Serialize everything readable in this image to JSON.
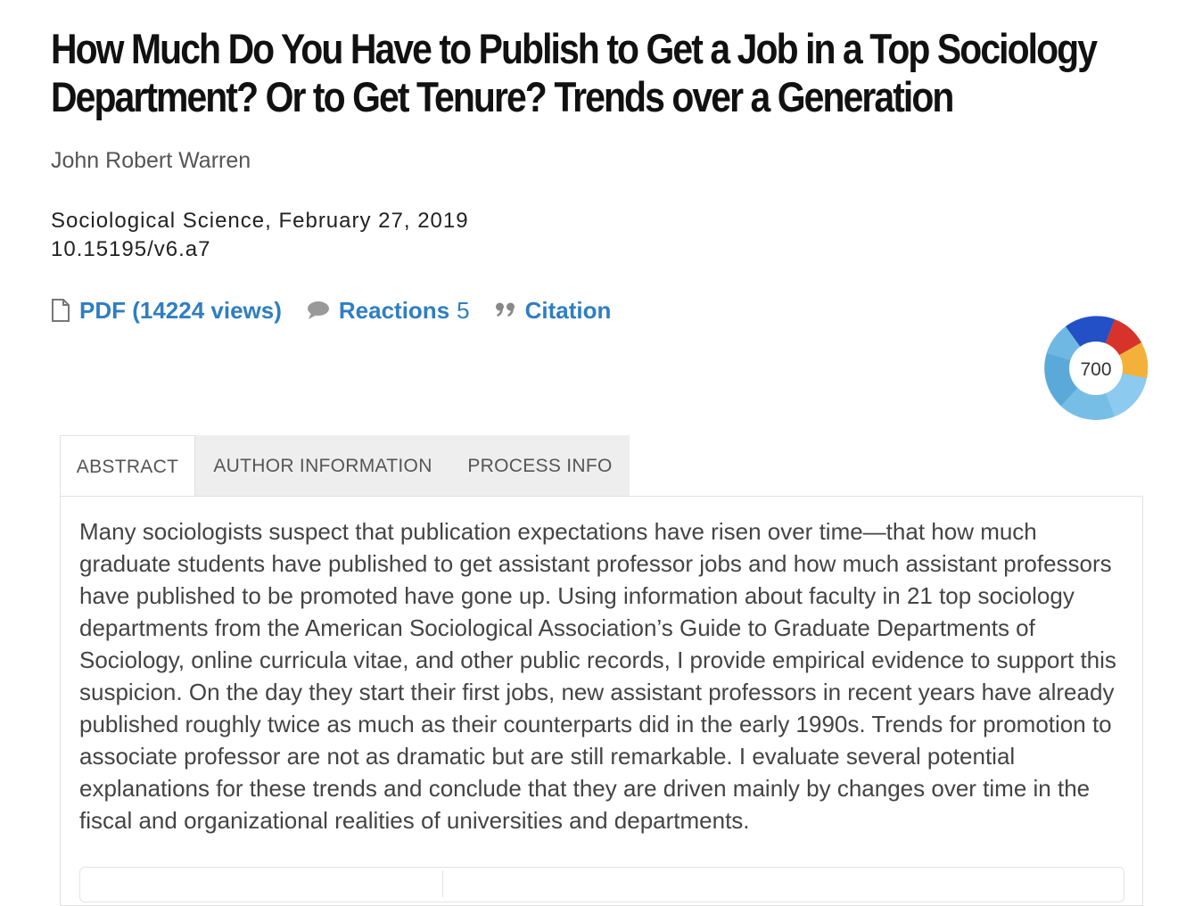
{
  "article": {
    "title": "How Much Do You Have to Publish to Get a Job in a Top Sociology Department? Or to Get Tenure? Trends over a Generation",
    "author": "John Robert Warren",
    "journal_date": "Sociological Science, February 27, 2019",
    "doi": "10.15195/v6.a7"
  },
  "actions": {
    "pdf_label": "PDF (14224 views)",
    "reactions_label": "Reactions",
    "reactions_count": "5",
    "citation_label": "Citation"
  },
  "altmetric": {
    "score": "700",
    "colors": [
      "#2350c6",
      "#d8332a",
      "#f4b13a",
      "#5fb0dd",
      "#8bc8ea"
    ]
  },
  "tabs": {
    "abstract": "ABSTRACT",
    "author_info": "AUTHOR INFORMATION",
    "process_info": "PROCESS INFO",
    "active": "abstract"
  },
  "abstract_text": "Many sociologists suspect that publication expectations have risen over time—that how much graduate students have published to get assistant professor jobs and how much assistant professors have published to be promoted have gone up. Using information about faculty in 21 top sociology departments from the American Sociological Association’s Guide to Graduate Departments of Sociology, online curricula vitae, and other public records, I provide empirical evidence to support this suspicion. On the day they start their first jobs, new assistant professors in recent years have already published roughly twice as much as their counterparts did in the early 1990s. Trends for promotion to associate professor are not as dramatic but are still remarkable. I evaluate several potential explanations for these trends and conclude that they are driven mainly by changes over time in the fiscal and organizational realities of universities and departments.",
  "colors": {
    "link": "#2f7ec2",
    "title": "#111111",
    "tab_bg": "#eeeeee"
  },
  "icons": {
    "pdf": "document-icon",
    "reactions": "speech-bubble-icon",
    "citation": "quote-icon"
  }
}
